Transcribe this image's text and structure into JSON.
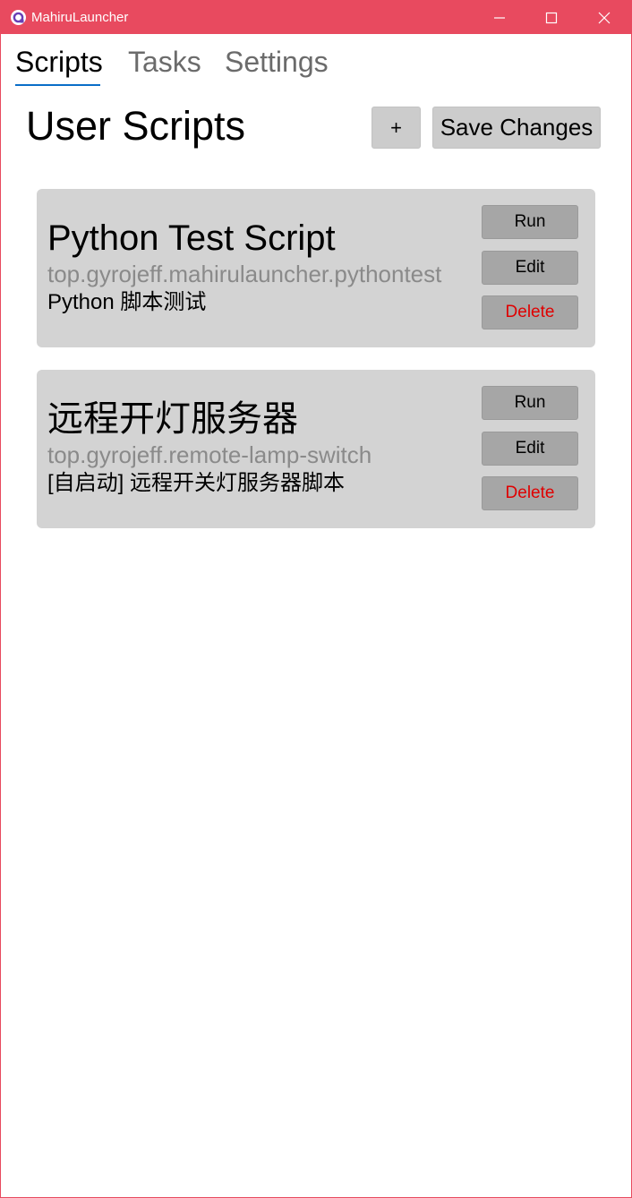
{
  "window": {
    "title": "MahiruLauncher",
    "accent_color": "#e84a5f",
    "controls": [
      "minimize-icon",
      "maximize-icon",
      "close-icon"
    ]
  },
  "tabs": [
    {
      "label": "Scripts",
      "active": true
    },
    {
      "label": "Tasks",
      "active": false
    },
    {
      "label": "Settings",
      "active": false
    }
  ],
  "page": {
    "title": "User Scripts",
    "add_label": "+",
    "save_label": "Save Changes"
  },
  "scripts": [
    {
      "name": "Python Test Script",
      "id": "top.gyrojeff.mahirulauncher.pythontest",
      "description": "Python 脚本测试",
      "run_label": "Run",
      "edit_label": "Edit",
      "delete_label": "Delete"
    },
    {
      "name": "远程开灯服务器",
      "id": "top.gyrojeff.remote-lamp-switch",
      "description": "[自启动] 远程开关灯服务器脚本",
      "run_label": "Run",
      "edit_label": "Edit",
      "delete_label": "Delete"
    }
  ],
  "colors": {
    "tab_underline": "#0a6ec8",
    "card_background": "#d3d3d3",
    "delete_text": "#e00000",
    "script_id_text": "#8a8a8a"
  }
}
